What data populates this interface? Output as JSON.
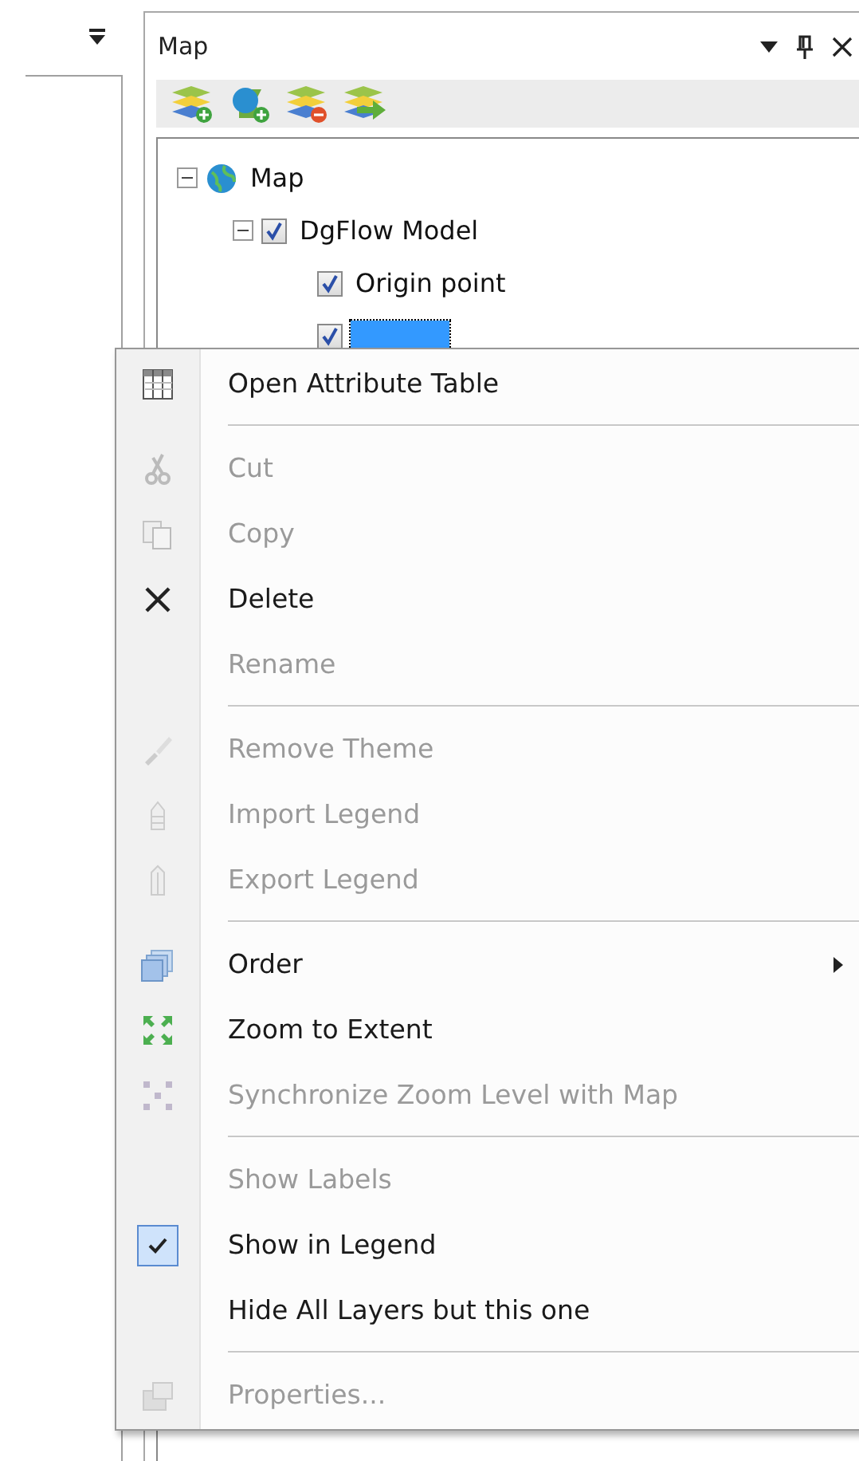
{
  "map_panel": {
    "title": "Map",
    "tree": [
      {
        "label": "Map",
        "kind": "globe",
        "selected": false,
        "expanded": true,
        "children": [
          {
            "label": "DgFlow Model",
            "kind": "layer",
            "checked": true,
            "selected": false,
            "expanded": true,
            "children": [
              {
                "label": "Origin point",
                "kind": "layer",
                "checked": true,
                "selected": false
              },
              {
                "kind": "layer",
                "checked": true,
                "selected": true
              }
            ]
          }
        ]
      }
    ]
  },
  "context_menu": {
    "items": [
      {
        "kind": "item",
        "label": "Open Attribute Table",
        "disabled": false,
        "checked": false,
        "submenu": false
      },
      {
        "kind": "separator"
      },
      {
        "kind": "item",
        "label": "Cut",
        "disabled": true,
        "checked": false,
        "submenu": false
      },
      {
        "kind": "item",
        "label": "Copy",
        "disabled": true,
        "checked": false,
        "submenu": false
      },
      {
        "kind": "item",
        "label": "Delete",
        "disabled": false,
        "checked": false,
        "submenu": false
      },
      {
        "kind": "item",
        "label": "Rename",
        "disabled": true,
        "checked": false,
        "submenu": false
      },
      {
        "kind": "separator"
      },
      {
        "kind": "item",
        "label": "Remove Theme",
        "disabled": true,
        "checked": false,
        "submenu": false
      },
      {
        "kind": "item",
        "label": "Import Legend",
        "disabled": true,
        "checked": false,
        "submenu": false
      },
      {
        "kind": "item",
        "label": "Export Legend",
        "disabled": true,
        "checked": false,
        "submenu": false
      },
      {
        "kind": "separator"
      },
      {
        "kind": "item",
        "label": "Order",
        "disabled": false,
        "checked": false,
        "submenu": true
      },
      {
        "kind": "item",
        "label": "Zoom to Extent",
        "disabled": false,
        "checked": false,
        "submenu": false
      },
      {
        "kind": "item",
        "label": "Synchronize Zoom Level with Map",
        "disabled": true,
        "checked": false,
        "submenu": false
      },
      {
        "kind": "separator"
      },
      {
        "kind": "item",
        "label": "Show Labels",
        "disabled": true,
        "checked": false,
        "submenu": false
      },
      {
        "kind": "item",
        "label": "Show in Legend",
        "disabled": false,
        "checked": true,
        "submenu": false
      },
      {
        "kind": "item",
        "label": "Hide All Layers but this one",
        "disabled": false,
        "checked": false,
        "submenu": false
      },
      {
        "kind": "separator"
      },
      {
        "kind": "item",
        "label": "Properties...",
        "disabled": true,
        "checked": false,
        "submenu": false
      }
    ]
  }
}
